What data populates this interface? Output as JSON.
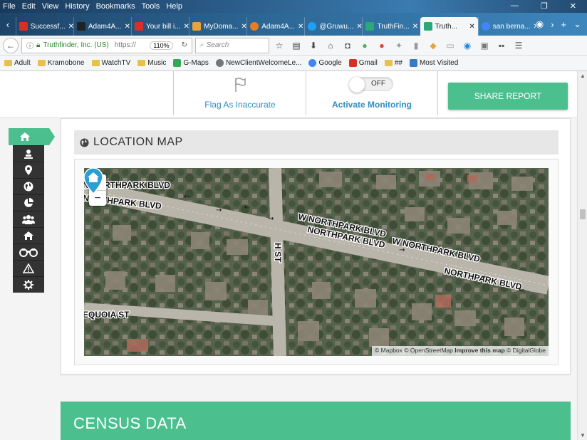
{
  "menubar": {
    "items": [
      "File",
      "Edit",
      "View",
      "History",
      "Bookmarks",
      "Tools",
      "Help"
    ],
    "window_controls": [
      "—",
      "❐",
      "✕"
    ]
  },
  "tabs": [
    {
      "label": "Successf...",
      "color": "#d93025"
    },
    {
      "label": "Adam4A...",
      "color": "#222222"
    },
    {
      "label": "Your bill i...",
      "color": "#d93025"
    },
    {
      "label": "MyDoma...",
      "color": "#e8a33a"
    },
    {
      "label": "Adam4A...",
      "color": "#e67e22"
    },
    {
      "label": "@Gruwu...",
      "color": "#1da1f2"
    },
    {
      "label": "TruthFin...",
      "color": "#2aa876"
    },
    {
      "label": "Truth...",
      "color": "#2aa876",
      "active": true
    },
    {
      "label": "san berna...",
      "color": "#4285f4"
    }
  ],
  "navbar": {
    "site": "Truthfinder, Inc. (US)",
    "scheme": "https://",
    "zoom": "110%",
    "search_placeholder": "Search"
  },
  "bookmarks": [
    {
      "label": "Adult",
      "type": "folder"
    },
    {
      "label": "Kramobone",
      "type": "folder"
    },
    {
      "label": "WatchTV",
      "type": "folder"
    },
    {
      "label": "Music",
      "type": "folder"
    },
    {
      "label": "G-Maps",
      "type": "icon",
      "color": "#34a853"
    },
    {
      "label": "NewClientWelcomeLe...",
      "type": "icon",
      "color": "#777777"
    },
    {
      "label": "Google",
      "type": "icon",
      "color": "#4285f4"
    },
    {
      "label": "Gmail",
      "type": "icon",
      "color": "#d93025"
    },
    {
      "label": "##",
      "type": "folder"
    },
    {
      "label": "Most Visited",
      "type": "icon",
      "color": "#3b78c4"
    }
  ],
  "actions": {
    "flag_label": "Flag As Inaccurate",
    "toggle_state": "OFF",
    "monitor_label": "Activate Monitoring",
    "share_label": "SHARE REPORT"
  },
  "location": {
    "title": "LOCATION MAP",
    "zoom_in": "+",
    "zoom_out": "−",
    "street_labels": {
      "northpark_top": "N NORTHPARK BLVD",
      "northpark_top2": "NORTHPARK BLVD",
      "w_northpark": "W NORTHPARK BLVD",
      "northpark_mid": "NORTHPARK BLVD",
      "w_northpark_right": "W NORTHPARK BLVD",
      "northpark_right": "NORTHPARK BLVD",
      "h_st": "H ST",
      "sequoia": "EQUOIA ST"
    },
    "attribution": {
      "mapbox": "© Mapbox",
      "osm": "© OpenStreetMap",
      "improve": "Improve this map",
      "digitalglobe": "© DigitalGlobe"
    }
  },
  "census": {
    "title": "CENSUS DATA"
  },
  "colors": {
    "accent": "#4cbf8f",
    "link": "#2f8fbf",
    "sidebar": "#333333",
    "pin": "#2a9fd6"
  }
}
